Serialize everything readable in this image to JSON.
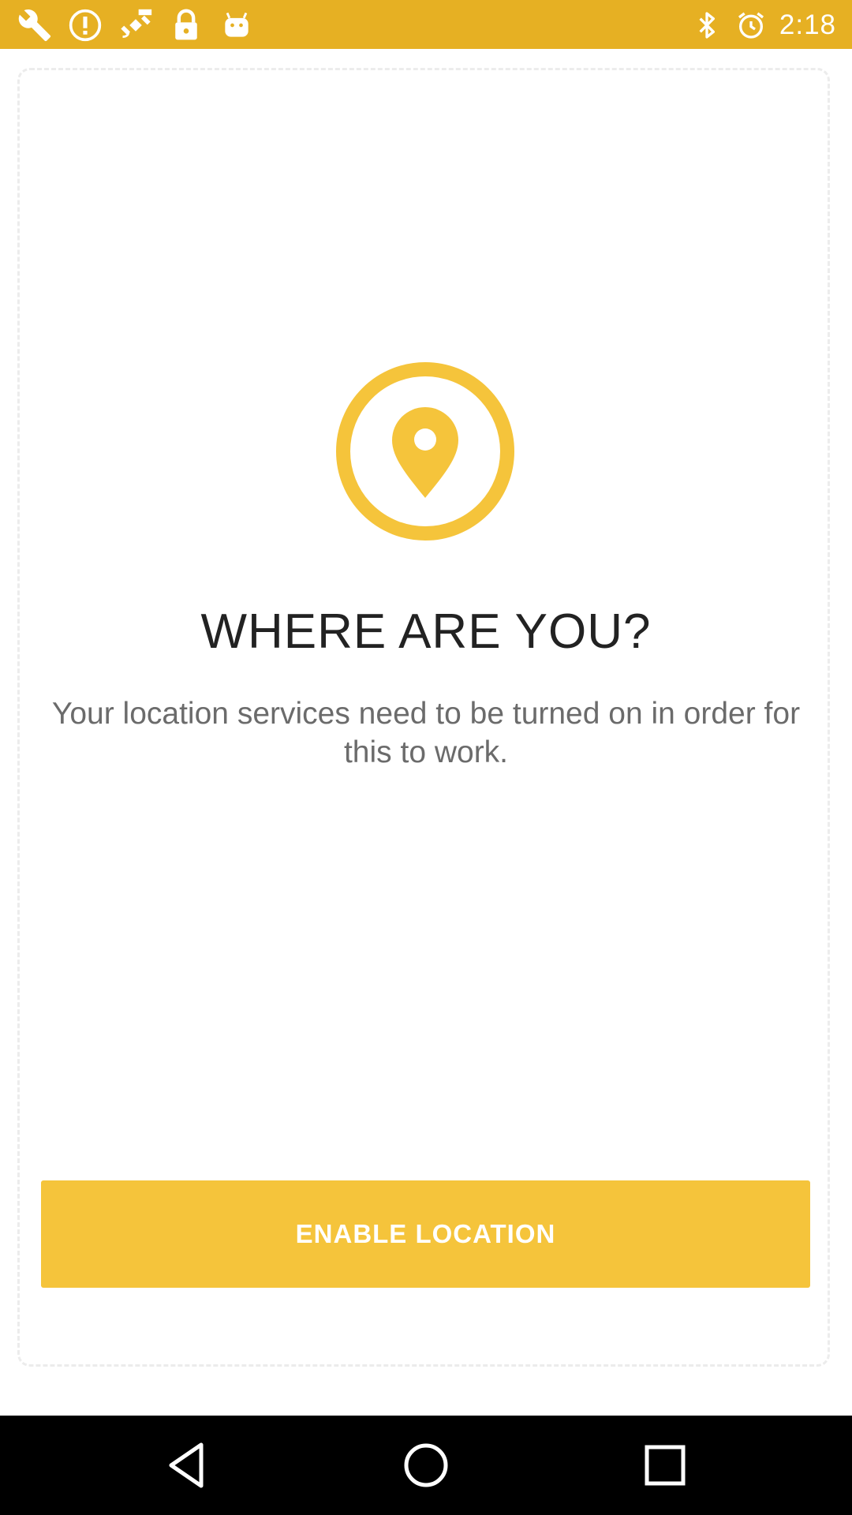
{
  "status_bar": {
    "background": "#e6b023",
    "left_icons": [
      "wrench-icon",
      "alert-icon",
      "fake-gps-icon",
      "lock-icon",
      "android-icon"
    ],
    "right_icons": [
      "bluetooth-icon",
      "alarm-icon"
    ],
    "time": "2:18"
  },
  "main": {
    "icon": "location-pin-icon",
    "accent_color": "#f5c43b",
    "title": "WHERE ARE YOU?",
    "subtitle": "Your location services need to be turned on in order for this to work.",
    "enable_button_label": "ENABLE LOCATION"
  },
  "nav_bar": {
    "buttons": [
      "back-icon",
      "home-icon",
      "recents-icon"
    ]
  }
}
